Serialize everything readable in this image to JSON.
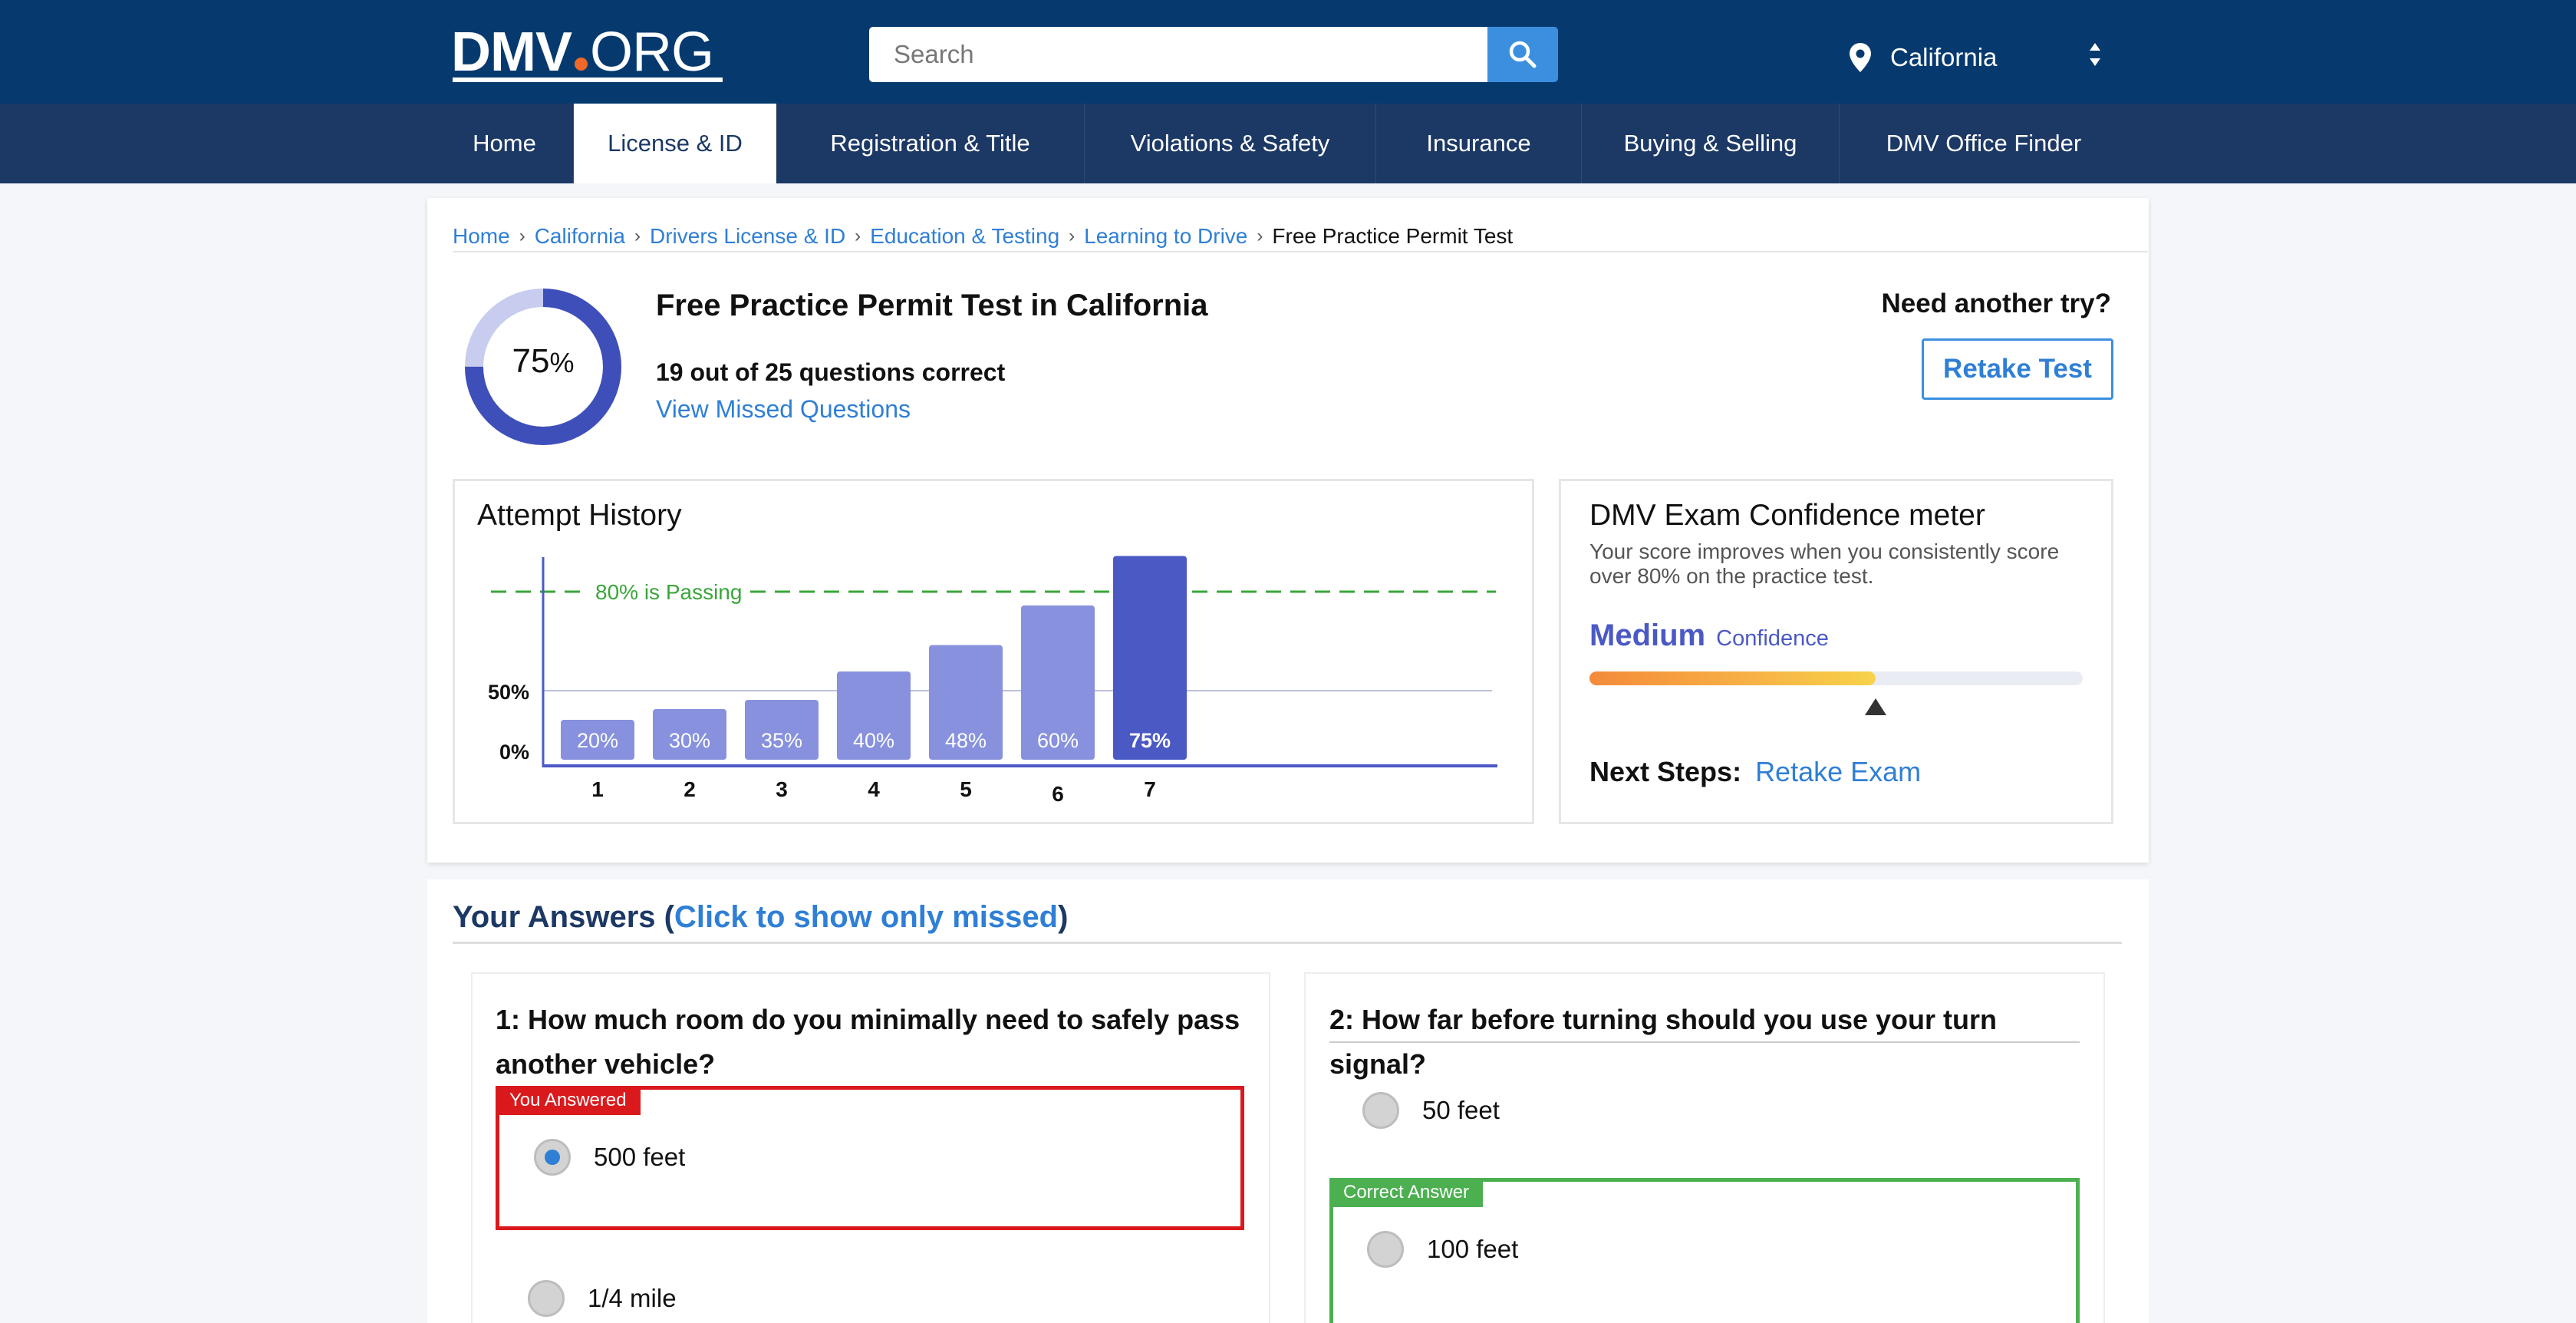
{
  "header": {
    "logo_main": "DMV",
    "logo_suffix": "ORG",
    "search_placeholder": "Search",
    "state": "California"
  },
  "nav": {
    "items": [
      {
        "label": "Home",
        "active": false
      },
      {
        "label": "License & ID",
        "active": true
      },
      {
        "label": "Registration & Title",
        "active": false
      },
      {
        "label": "Violations & Safety",
        "active": false
      },
      {
        "label": "Insurance",
        "active": false
      },
      {
        "label": "Buying & Selling",
        "active": false
      },
      {
        "label": "DMV Office Finder",
        "active": false
      }
    ]
  },
  "breadcrumb": {
    "items": [
      "Home",
      "California",
      "Drivers License & ID",
      "Education & Testing",
      "Learning to Drive"
    ],
    "current": "Free Practice Permit Test"
  },
  "result": {
    "score_value": "75",
    "score_percent_sign": "%",
    "score_fraction": 0.75,
    "title": "Free Practice Permit Test in California",
    "score_text": "19 out of 25 questions correct",
    "missed_link": "View Missed Questions",
    "retry_question": "Need another try?",
    "retake_button": "Retake Test"
  },
  "attempt_history": {
    "title": "Attempt History",
    "passing_label": "80% is Passing"
  },
  "chart_data": {
    "type": "bar",
    "categories": [
      "1",
      "2",
      "3",
      "4",
      "5",
      "6",
      "7"
    ],
    "values": [
      20,
      30,
      35,
      40,
      48,
      60,
      75
    ],
    "value_labels": [
      "20%",
      "30%",
      "35%",
      "40%",
      "48%",
      "60%",
      "75%"
    ],
    "y_tick_labels": [
      "0%",
      "50%"
    ],
    "y_ticks": [
      0,
      50
    ],
    "passing_line": 80,
    "passing_label": "80% is Passing",
    "highlight_index": 6,
    "colors": {
      "bar": "#8791de",
      "highlight": "#4b59c4",
      "pass_line": "#3aa63a",
      "axis": "#4b59c4"
    },
    "title": "Attempt History",
    "xlabel": "",
    "ylabel": ""
  },
  "confidence": {
    "title": "DMV Exam Confidence meter",
    "subtitle": "Your score improves when you consistently score over 80% on the practice test.",
    "level": "Medium",
    "level_suffix": "Confidence",
    "meter_fraction": 0.58,
    "next_steps_label": "Next Steps:",
    "next_steps_link": "Retake Exam"
  },
  "answers": {
    "heading_prefix": "Your Answers (",
    "toggle_link": "Click to show only missed",
    "heading_suffix": ")",
    "questions": [
      {
        "text": "1: How much room do you minimally need to safely pass another vehicle?",
        "tag": "You Answered",
        "selected_option": "500 feet",
        "other_option": "1/4 mile"
      },
      {
        "text": "2: How far before turning should you use your turn signal?",
        "first_option": "50 feet",
        "tag": "Correct Answer",
        "correct_option": "100 feet"
      }
    ]
  },
  "colors": {
    "header_bg": "#063a6f",
    "nav_bg": "#1c3865",
    "accent": "#2f7fd6",
    "wrong": "#d9191c",
    "correct": "#4caf50"
  }
}
